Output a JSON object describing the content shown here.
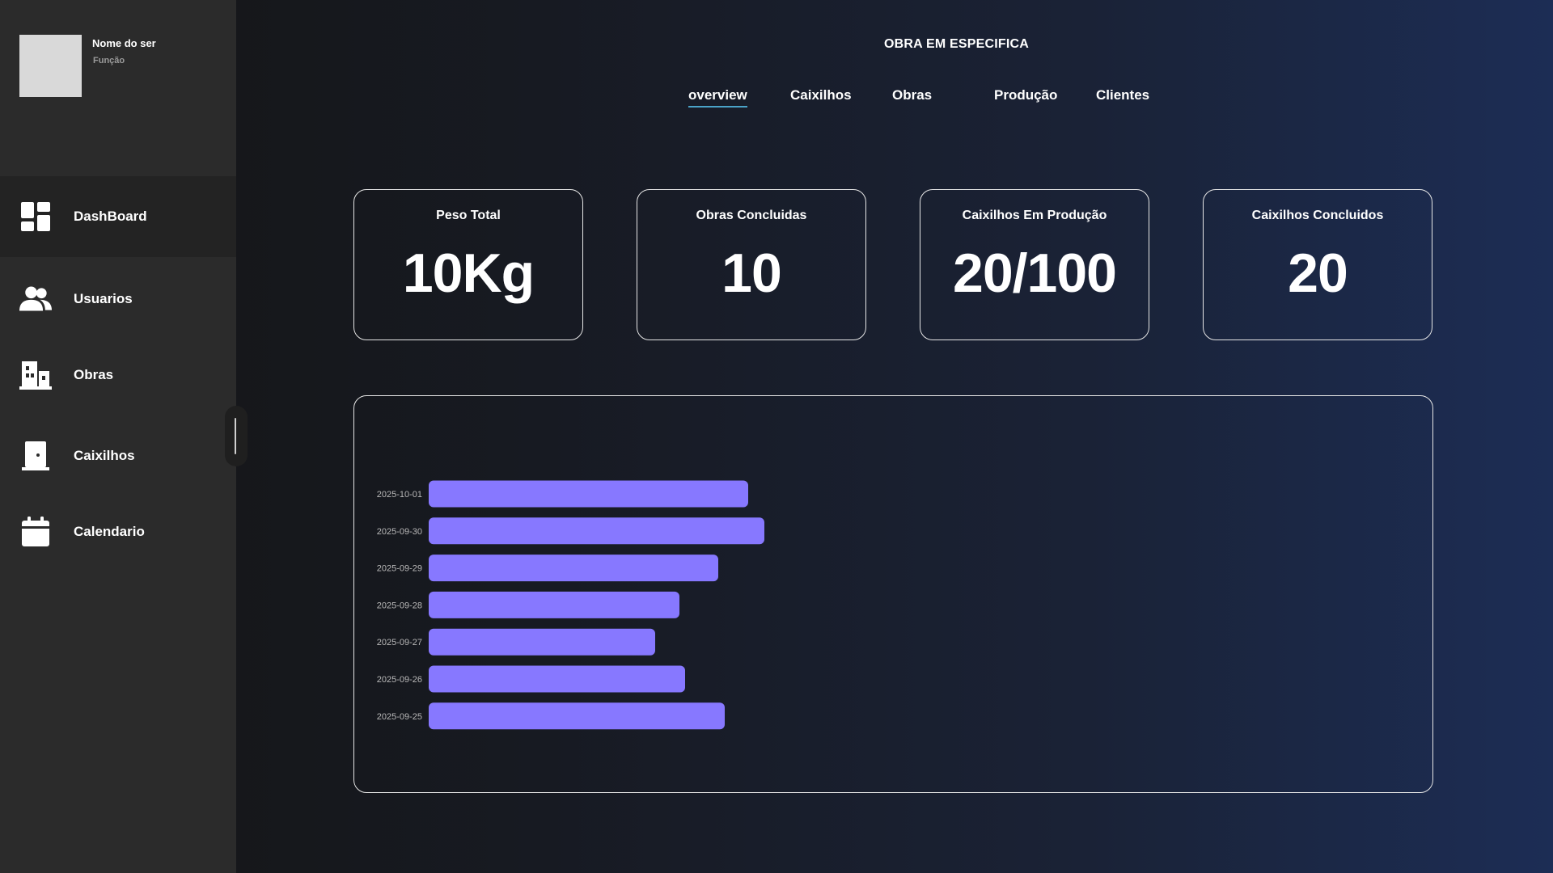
{
  "sidebar": {
    "profile": {
      "name": "Nome do ser",
      "role": "Função"
    },
    "items": [
      {
        "label": "DashBoard",
        "icon": "dashboard-icon",
        "active": true
      },
      {
        "label": "Usuarios",
        "icon": "users-icon",
        "active": false
      },
      {
        "label": "Obras",
        "icon": "building-icon",
        "active": false
      },
      {
        "label": "Caixilhos",
        "icon": "door-icon",
        "active": false
      },
      {
        "label": "Calendario",
        "icon": "calendar-icon",
        "active": false
      }
    ]
  },
  "header": {
    "title": "OBRA EM ESPECIFICA",
    "tabs": [
      {
        "label": "overview",
        "active": true
      },
      {
        "label": "Caixilhos",
        "active": false
      },
      {
        "label": "Obras",
        "active": false
      },
      {
        "label": "Produção",
        "active": false
      },
      {
        "label": "Clientes",
        "active": false
      }
    ]
  },
  "cards": [
    {
      "label": "Peso Total",
      "value": "10Kg"
    },
    {
      "label": "Obras Concluidas",
      "value": "10"
    },
    {
      "label": "Caixilhos Em Produção",
      "value": "20/100"
    },
    {
      "label": "Caixilhos Concluidos",
      "value": "20"
    }
  ],
  "colors": {
    "bar": "#8778ff",
    "sidebar_bg": "#2b2b2b",
    "tab_underline": "#4aa3c8"
  },
  "chart_data": {
    "type": "bar",
    "orientation": "horizontal",
    "categories": [
      "2025-10-01",
      "2025-09-30",
      "2025-09-29",
      "2025-09-28",
      "2025-09-27",
      "2025-09-26",
      "2025-09-25"
    ],
    "values": [
      395,
      415,
      358,
      310,
      280,
      317,
      366
    ],
    "xlim": [
      0,
      1225
    ],
    "grid": false
  }
}
